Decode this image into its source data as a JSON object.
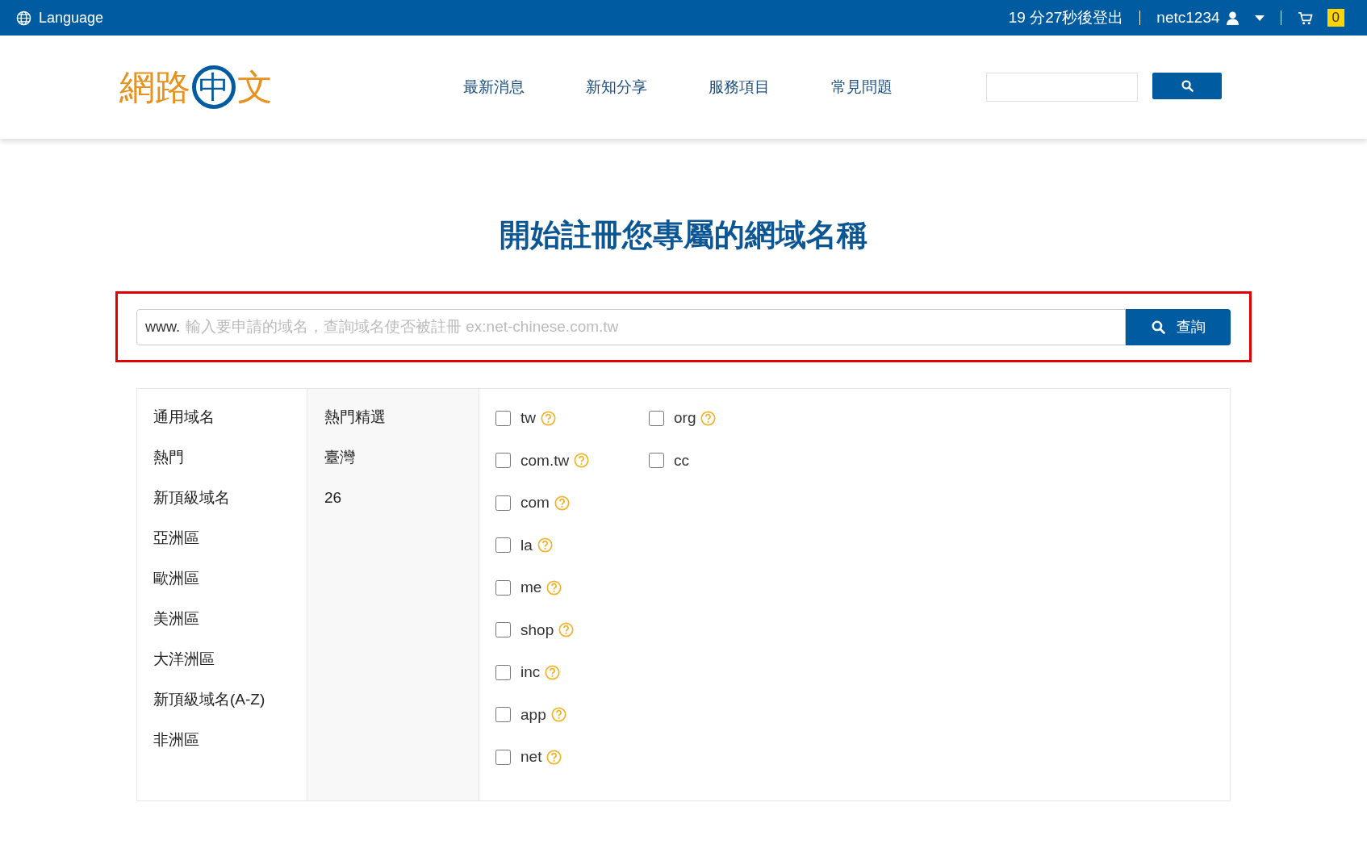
{
  "top_bar": {
    "language": "Language",
    "logout_timer": "19 分27秒後登出",
    "username": "netc1234",
    "cart_count": "0"
  },
  "header": {
    "logo": {
      "left": "網路",
      "center": "中",
      "right": "文"
    },
    "nav": [
      "最新消息",
      "新知分享",
      "服務項目",
      "常見問題"
    ]
  },
  "title": "開始註冊您專屬的網域名稱",
  "domain_search": {
    "prefix": "www.",
    "placeholder": "輸入要申請的域名，查詢域名使否被註冊 ex:net-chinese.com.tw",
    "button": "查詢"
  },
  "categories": [
    "通用域名",
    "熱門",
    "新頂級域名",
    "亞洲區",
    "歐洲區",
    "美洲區",
    "大洋洲區",
    "新頂級域名(A-Z)",
    "非洲區"
  ],
  "subcategories": [
    "熱門精選",
    "臺灣",
    "26"
  ],
  "domain_columns": [
    [
      {
        "name": "tw",
        "checked": false,
        "help": true
      },
      {
        "name": "com.tw",
        "checked": false,
        "help": true
      },
      {
        "name": "com",
        "checked": false,
        "help": true
      },
      {
        "name": "la",
        "checked": false,
        "help": true
      },
      {
        "name": "me",
        "checked": false,
        "help": true
      },
      {
        "name": "shop",
        "checked": false,
        "help": true
      },
      {
        "name": "inc",
        "checked": false,
        "help": true
      },
      {
        "name": "app",
        "checked": false,
        "help": true
      },
      {
        "name": "net",
        "checked": false,
        "help": true
      }
    ],
    [
      {
        "name": "org",
        "checked": false,
        "help": true
      },
      {
        "name": "cc",
        "checked": false,
        "help": false
      }
    ]
  ]
}
